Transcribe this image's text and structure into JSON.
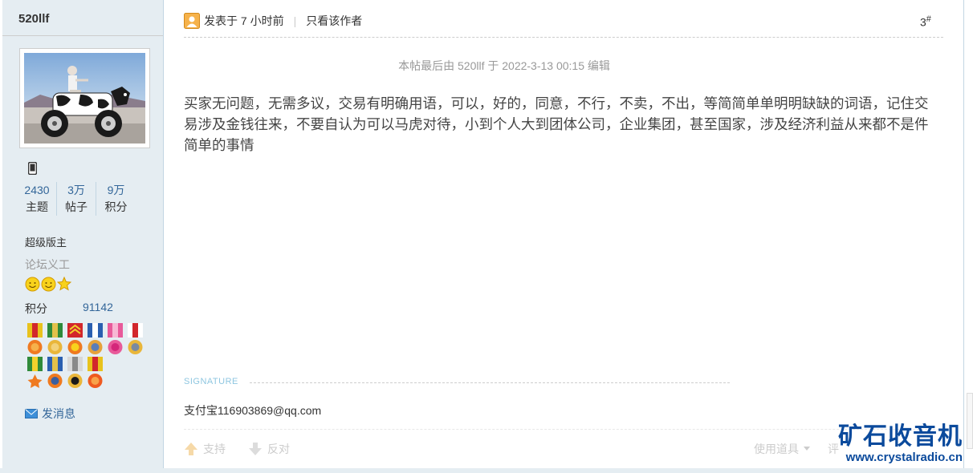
{
  "user": {
    "name": "520llf",
    "stats": [
      {
        "value": "2430",
        "label": "主题"
      },
      {
        "value": "3万",
        "label": "帖子"
      },
      {
        "value": "9万",
        "label": "积分"
      }
    ],
    "group": "超级版主",
    "subgroup": "论坛义工",
    "points_label": "积分",
    "points_value": "91142",
    "send_message": "发消息"
  },
  "post": {
    "posted_label": "发表于 7 小时前",
    "author_only": "只看该作者",
    "floor_number": "3",
    "floor_mark": "#",
    "edited_note": "本帖最后由 520llf 于 2022-3-13 00:15 编辑",
    "content": "买家无问题，无需多议，交易有明确用语，可以，好的，同意，不行，不卖，不出，等简简单单明明缺缺的词语，记住交易涉及金钱往来，不要自认为可以马虎对待，小到个人大到团体公司，企业集团，甚至国家，涉及经济利益从来都不是件简单的事情",
    "signature_label": "SIGNATURE",
    "signature": "支付宝116903869@qq.com",
    "support_label": "支持",
    "oppose_label": "反对",
    "tools_label": "使用道具",
    "rate_label": "评"
  },
  "watermark": {
    "cn": "矿石收音机",
    "url": "www.crystalradio.cn"
  },
  "colors": {
    "sidebar_bg": "#e5edf2",
    "link": "#336699",
    "watermark": "#0b4a9c"
  }
}
